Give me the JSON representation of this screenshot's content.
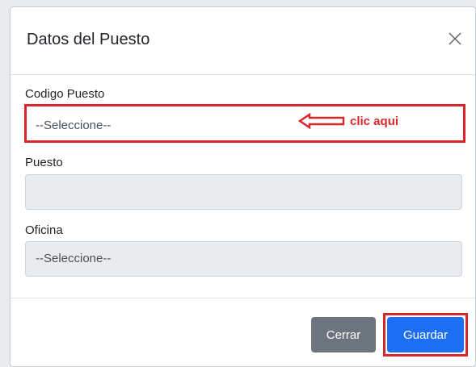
{
  "modal": {
    "title": "Datos del Puesto",
    "close_icon": "close-icon"
  },
  "form": {
    "codigo_puesto": {
      "label": "Codigo Puesto",
      "value": "--Seleccione--"
    },
    "puesto": {
      "label": "Puesto",
      "value": ""
    },
    "oficina": {
      "label": "Oficina",
      "value": "--Seleccione--"
    }
  },
  "annotation": {
    "text": "clic aqui",
    "icon": "left-arrow-icon",
    "color": "#d9262c"
  },
  "footer": {
    "cerrar_label": "Cerrar",
    "guardar_label": "Guardar"
  },
  "colors": {
    "primary": "#1a6ff5",
    "secondary": "#6c757d",
    "highlight": "#d9262c",
    "disabled_bg": "#e9ecef"
  }
}
